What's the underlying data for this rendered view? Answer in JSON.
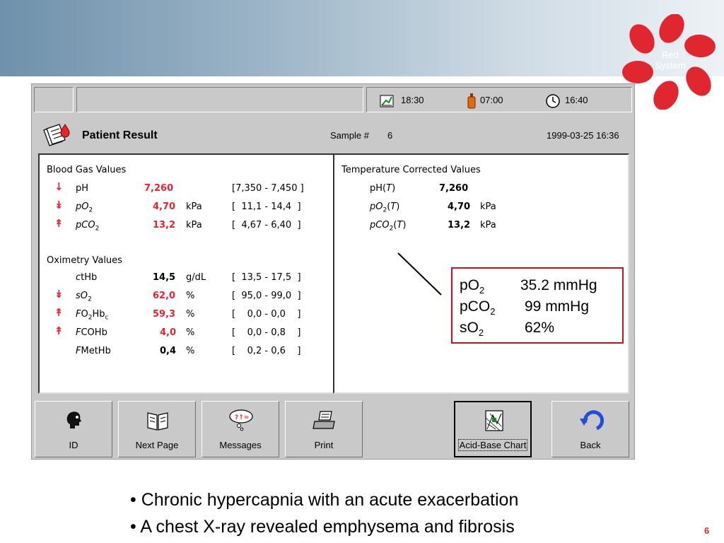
{
  "logo": {
    "line1": "Red",
    "line2": "System"
  },
  "statusbar": {
    "time1": "18:30",
    "time2": "07:00",
    "time3": "16:40"
  },
  "header": {
    "title": "Patient Result",
    "sample_label": "Sample #",
    "sample_value": "6",
    "datetime": "1999-03-25 16:36"
  },
  "blood_gas": {
    "heading": "Blood Gas Values",
    "rows": [
      {
        "name": "pH",
        "value": "7,260",
        "unit": "",
        "range": "[7,350 - 7,450 ]"
      },
      {
        "name": "pO",
        "sub": "2",
        "value": "4,70",
        "unit": "kPa",
        "range": "[  11,1 - 14,4  ]"
      },
      {
        "name": "pCO",
        "sub": "2",
        "value": "13,2",
        "unit": "kPa",
        "range": "[  4,67 - 6,40  ]"
      }
    ]
  },
  "oximetry": {
    "heading": "Oximetry Values",
    "rows": [
      {
        "pre": "c",
        "name": "tHb",
        "value": "14,5",
        "unit": "g/dL",
        "range": "[  13,5 - 17,5  ]"
      },
      {
        "name": "sO",
        "sub": "2",
        "value": "62,0",
        "unit": "%",
        "range": "[  95,0 - 99,0  ]"
      },
      {
        "pre": "F",
        "name": "O",
        "sub": "2",
        "name2": "Hb",
        "sub2": "c",
        "value": "59,3",
        "unit": "%",
        "range": "[    0,0 - 0,0    ]"
      },
      {
        "pre": "F",
        "name": "COHb",
        "value": "4,0",
        "unit": "%",
        "range": "[    0,0 - 0,8    ]"
      },
      {
        "pre": "F",
        "name": "MetHb",
        "value": "0,4",
        "unit": "%",
        "range": "[    0,2 - 0,6    ]"
      }
    ]
  },
  "temp_corrected": {
    "heading": "Temperature Corrected Values",
    "rows": [
      {
        "name": "pH(",
        "t": "T",
        "close": ")",
        "value": "7,260",
        "unit": ""
      },
      {
        "name": "pO",
        "sub": "2",
        "t": "T",
        "value": "4,70",
        "unit": "kPa"
      },
      {
        "name": "pCO",
        "sub": "2",
        "t": "T",
        "value": "13,2",
        "unit": "kPa"
      }
    ]
  },
  "callout": {
    "rows": [
      {
        "label": "pO",
        "sub": "2",
        "value": "35.2 mmHg"
      },
      {
        "label": "pCO",
        "sub": "2",
        "value": "99 mmHg"
      },
      {
        "label": "sO",
        "sub": "2",
        "value": "62%"
      }
    ]
  },
  "buttons": [
    {
      "label": "ID",
      "icon": "person-head-icon"
    },
    {
      "label": "Next Page",
      "icon": "book-icon"
    },
    {
      "label": "Messages",
      "icon": "thought-bubble-icon"
    },
    {
      "label": "Print",
      "icon": "printer-icon"
    },
    {
      "label": "Acid-Base Chart",
      "icon": "chart-icon"
    },
    {
      "label": "Back",
      "icon": "back-arrow-icon"
    }
  ],
  "bullets": [
    "• Chronic hypercapnia with an acute exacerbation",
    "• A chest X-ray revealed emphysema and fibrosis"
  ],
  "page_number": "6",
  "colors": {
    "accent_red": "#e8232e",
    "callout_border": "#c0141c",
    "device_gray": "#c9c9c9"
  }
}
